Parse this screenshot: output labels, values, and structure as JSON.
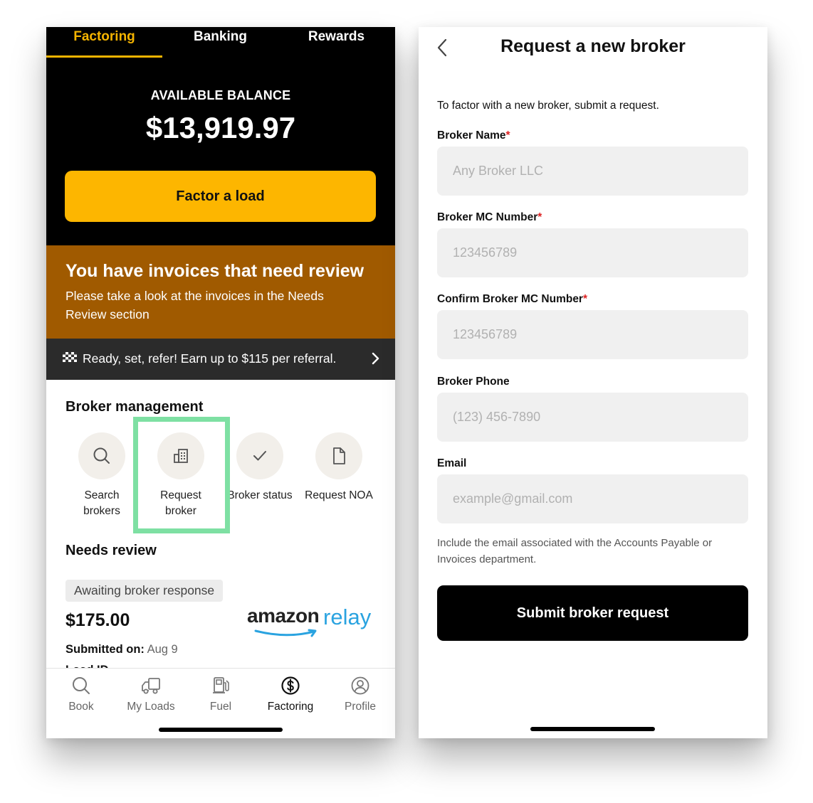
{
  "left": {
    "tabs": [
      {
        "label": "Factoring",
        "active": true
      },
      {
        "label": "Banking",
        "active": false
      },
      {
        "label": "Rewards",
        "active": false
      }
    ],
    "balance": {
      "label": "AVAILABLE BALANCE",
      "amount": "$13,919.97"
    },
    "factor_button": "Factor a load",
    "alert": {
      "title": "You have invoices that need review",
      "body": "Please take a look at the invoices in the Needs Review section"
    },
    "refer_banner": "Ready, set, refer! Earn up to $115 per referral.",
    "broker_management": {
      "heading": "Broker management",
      "items": [
        {
          "label": "Search brokers",
          "icon": "search-icon"
        },
        {
          "label": "Request broker",
          "icon": "building-icon"
        },
        {
          "label": "Broker status",
          "icon": "check-icon"
        },
        {
          "label": "Request NOA",
          "icon": "document-icon"
        }
      ]
    },
    "needs_review": {
      "heading": "Needs review",
      "badge": "Awaiting broker response",
      "amount": "$175.00",
      "logo_brand": "amazon",
      "logo_product": "relay",
      "submitted_label": "Submitted on:",
      "submitted_value": "Aug 9",
      "cut_text": "Load ID"
    },
    "bottom_nav": [
      {
        "label": "Book",
        "icon": "search-icon"
      },
      {
        "label": "My Loads",
        "icon": "truck-icon"
      },
      {
        "label": "Fuel",
        "icon": "fuel-pump-icon"
      },
      {
        "label": "Factoring",
        "icon": "dollar-circle-icon",
        "active": true
      },
      {
        "label": "Profile",
        "icon": "profile-icon"
      }
    ],
    "colors": {
      "accent": "#fdb600",
      "alert_bg": "#a05a00",
      "highlight": "#7ee0a3"
    }
  },
  "right": {
    "title": "Request a new broker",
    "intro": "To factor with a new broker, submit a request.",
    "fields": [
      {
        "label": "Broker Name",
        "required": "*",
        "placeholder": "Any Broker LLC"
      },
      {
        "label": "Broker MC Number",
        "required": "*",
        "placeholder": "123456789"
      },
      {
        "label": "Confirm Broker MC Number",
        "required": "*",
        "placeholder": "123456789"
      },
      {
        "label": "Broker Phone",
        "required": "",
        "placeholder": "(123) 456-7890"
      },
      {
        "label": "Email",
        "required": "",
        "placeholder": "example@gmail.com"
      }
    ],
    "note": "Include the email associated with the Accounts Payable or Invoices department.",
    "submit_button": "Submit broker request"
  }
}
